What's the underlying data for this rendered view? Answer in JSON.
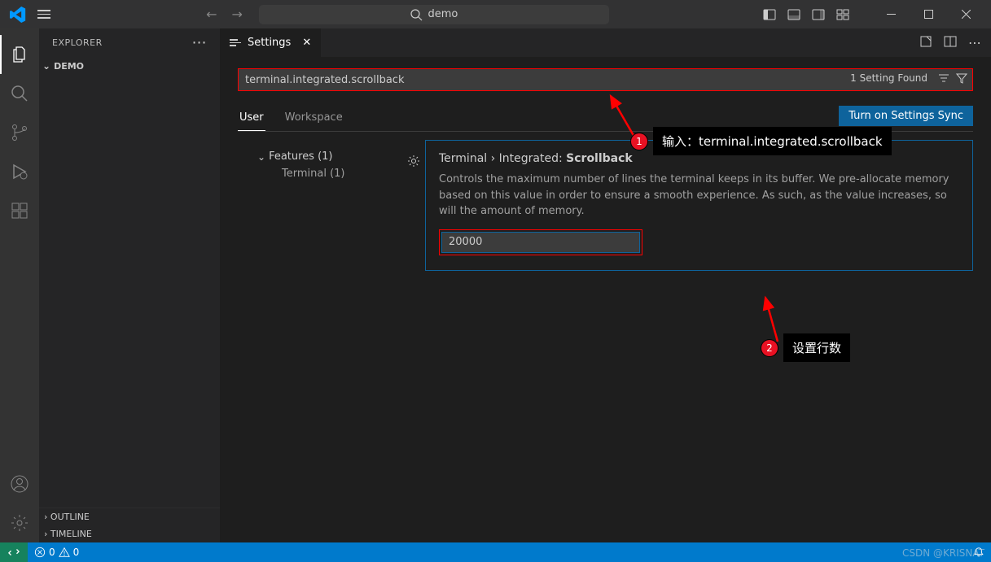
{
  "titlebar": {
    "search_placeholder": "demo"
  },
  "sidebar": {
    "title": "EXPLORER",
    "folder": "DEMO",
    "outline": "OUTLINE",
    "timeline": "TIMELINE"
  },
  "tab": {
    "label": "Settings"
  },
  "settings": {
    "search_value": "terminal.integrated.scrollback",
    "found_label": "1 Setting Found",
    "scope_user": "User",
    "scope_workspace": "Workspace",
    "sync_button": "Turn on Settings Sync",
    "toc_features": "Features (1)",
    "toc_terminal": "Terminal (1)",
    "setting_breadcrumb": "Terminal › Integrated: ",
    "setting_name": "Scrollback",
    "setting_desc": "Controls the maximum number of lines the terminal keeps in its buffer. We pre-allocate memory based on this value in order to ensure a smooth experience. As such, as the value increases, so will the amount of memory.",
    "setting_value": "20000"
  },
  "annotations": {
    "step1": "输入：terminal.integrated.scrollback",
    "step2": "设置行数",
    "badge1": "1",
    "badge2": "2"
  },
  "statusbar": {
    "errors": "0",
    "warnings": "0"
  },
  "watermark": "CSDN @KRISNAT"
}
